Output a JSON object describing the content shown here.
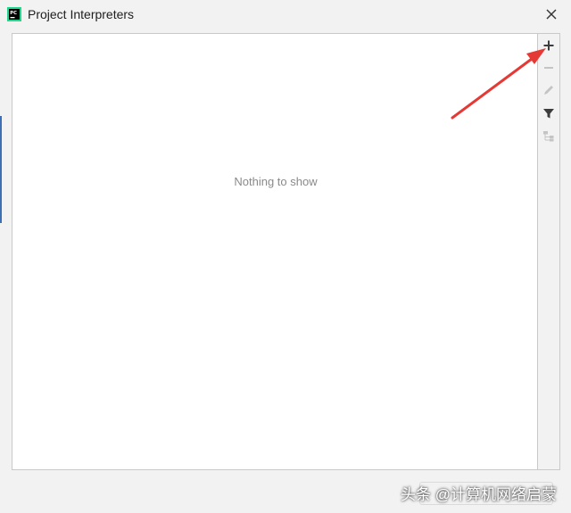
{
  "window": {
    "title": "Project Interpreters",
    "icons": {
      "app": "pycharm-app-icon",
      "close": "close-icon"
    }
  },
  "list": {
    "empty_text": "Nothing to show"
  },
  "toolbar": {
    "items": [
      {
        "name": "add-icon",
        "enabled": true
      },
      {
        "name": "remove-icon",
        "enabled": false
      },
      {
        "name": "edit-icon",
        "enabled": false
      },
      {
        "name": "filter-icon",
        "enabled": true
      },
      {
        "name": "show-paths-icon",
        "enabled": false
      }
    ]
  },
  "annotation": {
    "arrow_color": "#e53935"
  },
  "watermark": {
    "text": "头条 @计算机网络启蒙"
  },
  "colors": {
    "window_bg": "#f2f2f2",
    "panel_bg": "#ffffff",
    "border": "#c9c9c9",
    "muted_text": "#8a8a8a"
  }
}
